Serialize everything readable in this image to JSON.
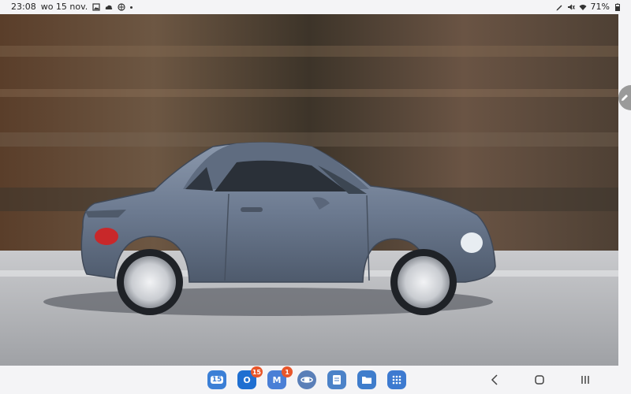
{
  "status_bar": {
    "time": "23:08",
    "date": "wo 15 nov.",
    "battery_percent": "71%",
    "left_icons": [
      "gallery-icon",
      "cloud-icon",
      "vpn-icon",
      "notification-dot"
    ],
    "right_icons": [
      "pen-icon",
      "mute-icon",
      "wifi-icon",
      "battery-icon"
    ]
  },
  "photo": {
    "subject": "car-photo",
    "edge_handle_icon": "pencil-icon"
  },
  "taskbar": {
    "apps": [
      {
        "name": "calendar",
        "label": "15",
        "color": "#3b7fd6"
      },
      {
        "name": "outlook",
        "label": "O",
        "color": "#1f6fd1",
        "badge": "15"
      },
      {
        "name": "gmail",
        "label": "M",
        "color": "#4a7fd6",
        "badge": "1"
      },
      {
        "name": "internet",
        "label": "",
        "color": "#5a7fb8"
      },
      {
        "name": "notes",
        "label": "",
        "color": "#4b82c8"
      },
      {
        "name": "files",
        "label": "",
        "color": "#3f7dcc"
      },
      {
        "name": "app-drawer",
        "label": "",
        "color": "#3d7ad0"
      }
    ],
    "nav": {
      "back": "back-icon",
      "home": "home-icon",
      "recents": "recents-icon"
    }
  }
}
